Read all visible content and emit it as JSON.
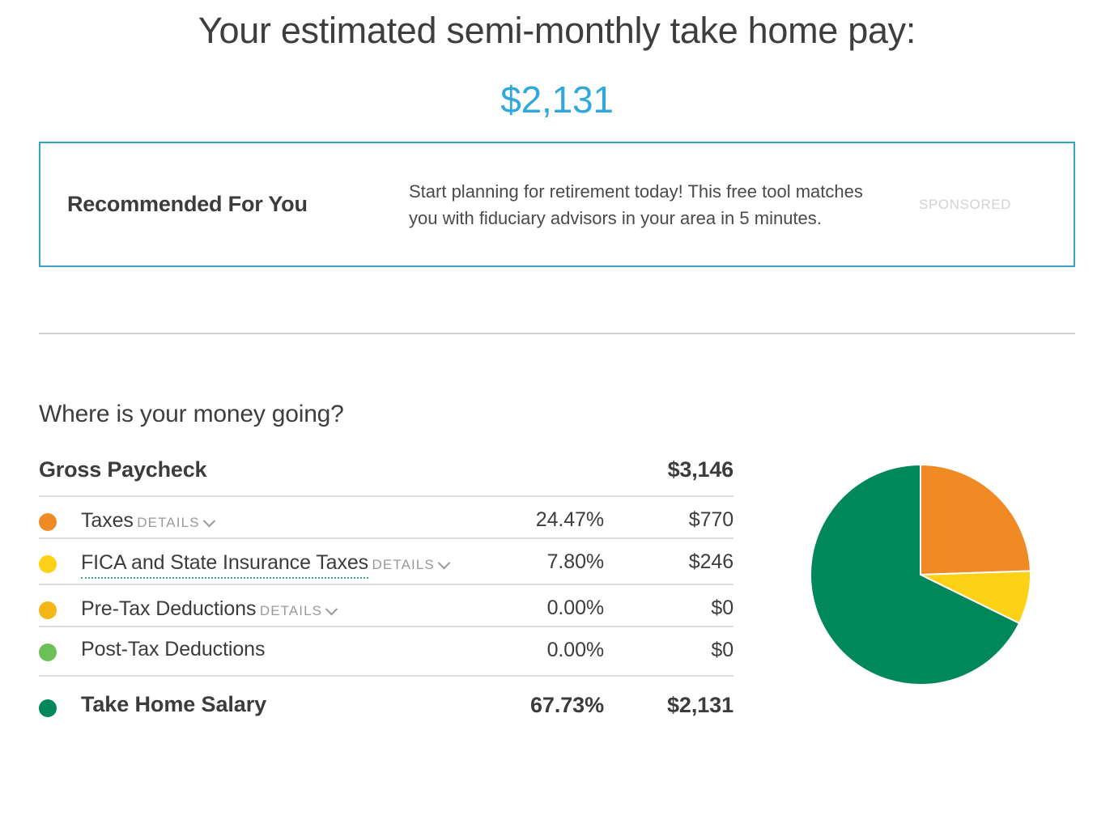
{
  "header": {
    "headline": "Your estimated semi-monthly take home pay:",
    "amount": "$2,131",
    "amount_color": "#31a8dd"
  },
  "promo": {
    "title": "Recommended For You",
    "body": "Start planning for retirement today! This free tool matches you with fiduciary advisors in your area in 5 minutes.",
    "sponsored_label": "SPONSORED",
    "border_color": "#36a3c7"
  },
  "breakdown": {
    "section_title": "Where is your money going?",
    "gross": {
      "label": "Gross Paycheck",
      "value": "$3,146"
    },
    "details_label": "DETAILS",
    "rows": [
      {
        "label": "Taxes",
        "percent": "24.47%",
        "amount": "$770",
        "color": "#f08a24",
        "has_details": true,
        "tooltip": false,
        "bold": false
      },
      {
        "label": "FICA and State Insurance Taxes",
        "percent": "7.80%",
        "amount": "$246",
        "color": "#fcd116",
        "has_details": true,
        "tooltip": true,
        "bold": false
      },
      {
        "label": "Pre-Tax Deductions",
        "percent": "0.00%",
        "amount": "$0",
        "color": "#f5b617",
        "has_details": true,
        "tooltip": false,
        "bold": false
      },
      {
        "label": "Post-Tax Deductions",
        "percent": "0.00%",
        "amount": "$0",
        "color": "#6cc05a",
        "has_details": false,
        "tooltip": false,
        "bold": false
      },
      {
        "label": "Take Home Salary",
        "percent": "67.73%",
        "amount": "$2,131",
        "color": "#00875a",
        "has_details": false,
        "tooltip": false,
        "bold": true
      }
    ]
  },
  "chart_data": {
    "type": "pie",
    "title": "Where is your money going?",
    "labels": [
      "Taxes",
      "FICA and State Insurance Taxes",
      "Pre-Tax Deductions",
      "Post-Tax Deductions",
      "Take Home Salary"
    ],
    "values": [
      24.47,
      7.8,
      0.0,
      0.0,
      67.73
    ],
    "amounts": [
      770,
      246,
      0,
      0,
      2131
    ],
    "total": 3146,
    "total_label": "Gross Paycheck",
    "colors": [
      "#f08a24",
      "#fcd116",
      "#f5b617",
      "#6cc05a",
      "#00875a"
    ],
    "unit": "%",
    "start_angle_deg": 0,
    "direction": "clockwise",
    "legend": "left-table",
    "grid": false
  }
}
